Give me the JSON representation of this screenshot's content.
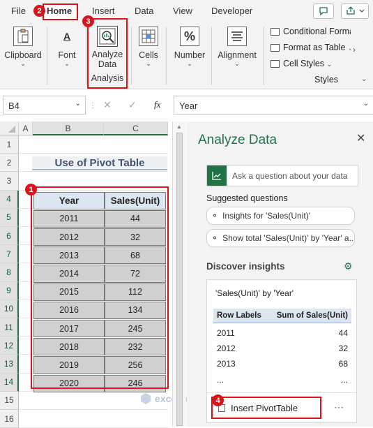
{
  "tabs": [
    "File",
    "Home",
    "Insert",
    "Data",
    "View",
    "Developer"
  ],
  "ribbon": {
    "clipboard": "Clipboard",
    "font": "Font",
    "analyze": "Analyze Data",
    "analysis_group": "Analysis",
    "cells": "Cells",
    "number": "Number",
    "alignment": "Alignment",
    "styles_items": [
      "Conditional Forma",
      "Format as Table",
      "Cell Styles"
    ],
    "styles_group": "Styles",
    "number_icon": "%",
    "font_icon": "A"
  },
  "formula_bar": {
    "name_box": "B4",
    "fx": "fx",
    "value": "Year"
  },
  "sheet": {
    "columns": [
      "A",
      "B",
      "C"
    ],
    "rows": [
      "1",
      "2",
      "3",
      "4",
      "5",
      "6",
      "7",
      "8",
      "9",
      "10",
      "11",
      "12",
      "13",
      "14",
      "15",
      "16"
    ],
    "title": "Use of Pivot Table",
    "headers": [
      "Year",
      "Sales(Unit)"
    ],
    "data": [
      [
        "2011",
        "44"
      ],
      [
        "2012",
        "32"
      ],
      [
        "2013",
        "68"
      ],
      [
        "2014",
        "72"
      ],
      [
        "2015",
        "112"
      ],
      [
        "2016",
        "134"
      ],
      [
        "2017",
        "245"
      ],
      [
        "2018",
        "232"
      ],
      [
        "2019",
        "256"
      ],
      [
        "2020",
        "246"
      ]
    ]
  },
  "pane": {
    "title": "Analyze Data",
    "ask_placeholder": "Ask a question about your data",
    "suggested_label": "Suggested questions",
    "suggestions": [
      "Insights for 'Sales(Unit)'",
      "Show total 'Sales(Unit)' by 'Year' a..."
    ],
    "discover_label": "Discover insights",
    "card_title": "'Sales(Unit)' by 'Year'",
    "table_headers": [
      "Row Labels",
      "Sum of Sales(Unit)"
    ],
    "table_rows": [
      [
        "2011",
        "44"
      ],
      [
        "2012",
        "32"
      ],
      [
        "2013",
        "68"
      ]
    ],
    "ellipsis": "...",
    "insert_button": "Insert PivotTable"
  },
  "badges": [
    "1",
    "2",
    "3",
    "4"
  ],
  "watermark": "exceldemy"
}
